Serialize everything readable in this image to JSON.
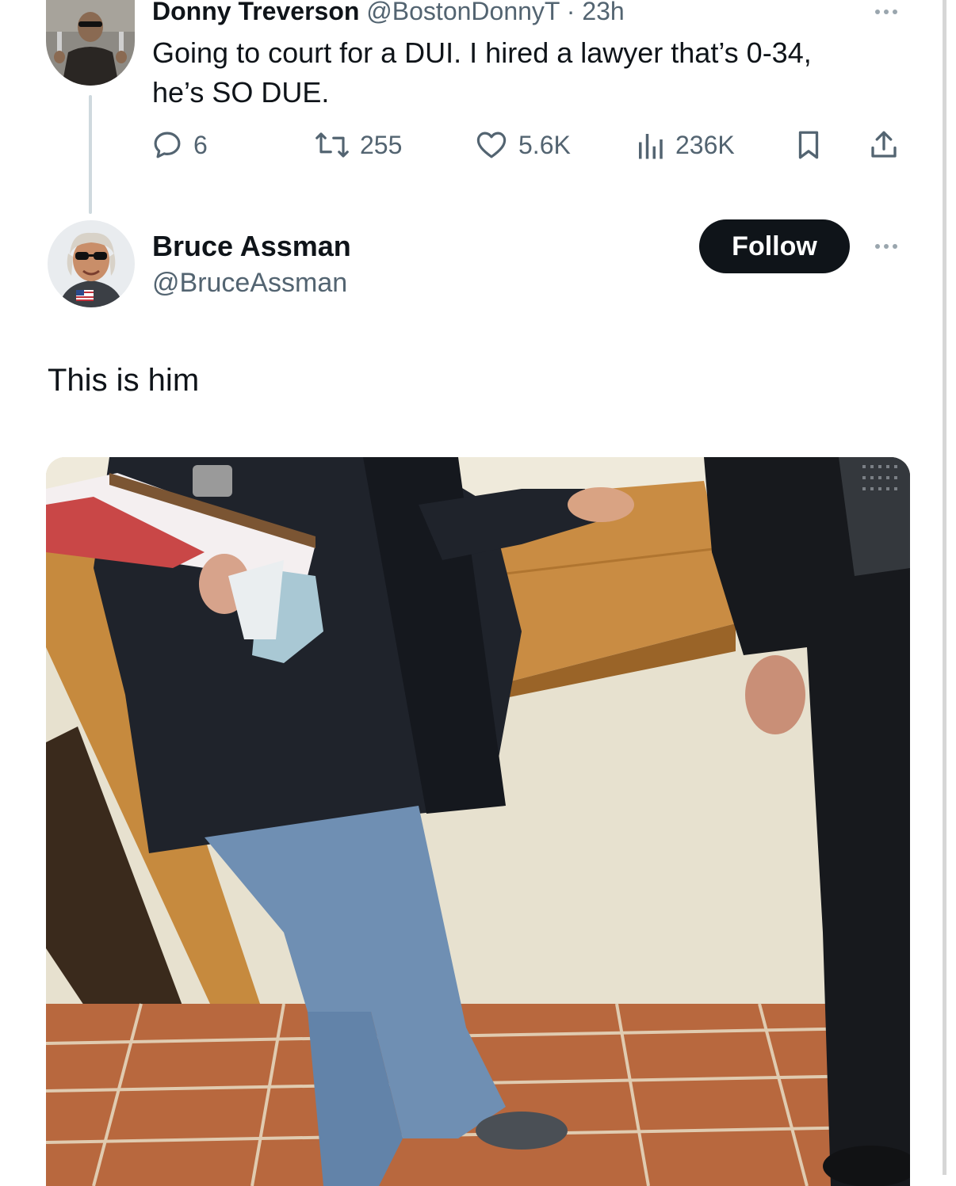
{
  "original_tweet": {
    "display_name": "Donny Treverson",
    "handle": "@BostonDonnyT",
    "separator": "·",
    "time": "23h",
    "text_line1": "Going to court for a DUI. I hired a lawyer that’s 0-34,",
    "text_line2": "he’s SO DUE.",
    "stats": {
      "replies": "6",
      "reposts": "255",
      "likes": "5.6K",
      "views": "236K"
    }
  },
  "reply_tweet": {
    "display_name": "Bruce Assman",
    "handle": "@BruceAssman",
    "follow_label": "Follow",
    "text": "This is him"
  },
  "colors": {
    "text_primary": "#0f1419",
    "text_secondary": "#536471",
    "follow_button": "#0f1419",
    "thread_line": "#cfd9de"
  },
  "icons": {
    "reply": "speech-bubble-icon",
    "repost": "repost-arrows-icon",
    "like": "heart-icon",
    "views": "bar-chart-icon",
    "bookmark": "bookmark-icon",
    "share": "share-upload-icon",
    "more": "more-dots-icon"
  }
}
